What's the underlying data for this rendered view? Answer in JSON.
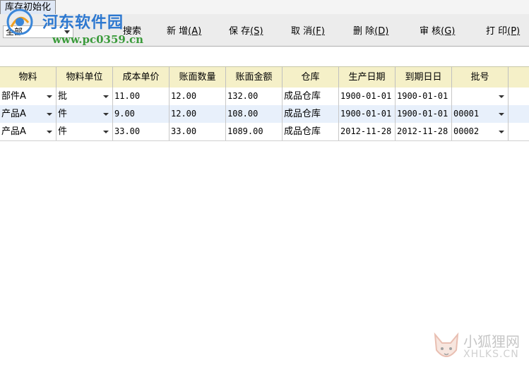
{
  "window": {
    "tab_title": "库存初始化"
  },
  "toolbar": {
    "filter_value": "全部",
    "buttons": [
      {
        "label": "搜索",
        "hotkey": ""
      },
      {
        "label": "新 增",
        "hotkey": "(A)"
      },
      {
        "label": "保 存",
        "hotkey": "(S)"
      },
      {
        "label": "取 消",
        "hotkey": "(F)"
      },
      {
        "label": "删 除",
        "hotkey": "(D)"
      },
      {
        "label": "审  核",
        "hotkey": "(G)"
      },
      {
        "label": "打 印",
        "hotkey": "(P)"
      }
    ]
  },
  "watermark_top": {
    "title": "河东软件园",
    "url": "www.pc0359.cn"
  },
  "watermark_bottom": {
    "title": "小狐狸网",
    "url": "XHLKS.CN"
  },
  "table": {
    "headers": [
      "物料",
      "物料单位",
      "成本单价",
      "账面数量",
      "账面金额",
      "仓库",
      "生产日期",
      "到期日日",
      "批号"
    ],
    "rows": [
      [
        "部件A",
        "批",
        "11.00",
        "12.00",
        "132.00",
        "成品仓库",
        "1900-01-01",
        "1900-01-01",
        ""
      ],
      [
        "产品A",
        "件",
        "9.00",
        "12.00",
        "108.00",
        "成品仓库",
        "1900-01-01",
        "1900-01-01",
        "00001"
      ],
      [
        "产品A",
        "件",
        "33.00",
        "33.00",
        "1089.00",
        "成品仓库",
        "2012-11-28",
        "2012-11-28",
        "00002"
      ]
    ]
  },
  "colors": {
    "header_bg": "#f5f0c8",
    "selected_row_bg": "#e8f0fb",
    "watermark_blue": "#2d78d0",
    "watermark_green": "#3a9a3a"
  }
}
